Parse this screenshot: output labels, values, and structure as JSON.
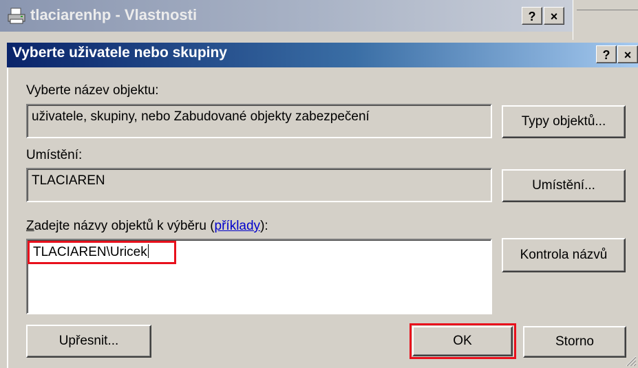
{
  "background_window": {
    "title": "tlaciarenhp - Vlastnosti",
    "help_button": "?",
    "close_button": "×",
    "icon": "printer-icon"
  },
  "dialog": {
    "title": "Vyberte uživatele nebo skupiny",
    "help_button": "?",
    "close_button": "×",
    "object_type_label": "Vyberte název objektu:",
    "object_type_value": "uživatele, skupiny, nebo Zabudované objekty zabezpečení",
    "object_types_button": "Typy objektů...",
    "location_label": "Umístění:",
    "location_value": "TLACIAREN",
    "locations_button": "Umístění...",
    "names_label_first_letter": "Z",
    "names_label_rest": "adejte názvy objektů k výběru (",
    "examples_link": "příklady",
    "names_label_end": "):",
    "names_value": "TLACIAREN\\Uricek",
    "check_names_button": "Kontrola názvů",
    "advanced_button": "Upřesnit...",
    "ok_button": "OK",
    "cancel_button": "Storno"
  },
  "colors": {
    "title_active": "#0a246a",
    "title_inactive": "#8a96b0",
    "face": "#d4d0c8",
    "highlight_box": "#e8101c",
    "link": "#0000cc"
  }
}
